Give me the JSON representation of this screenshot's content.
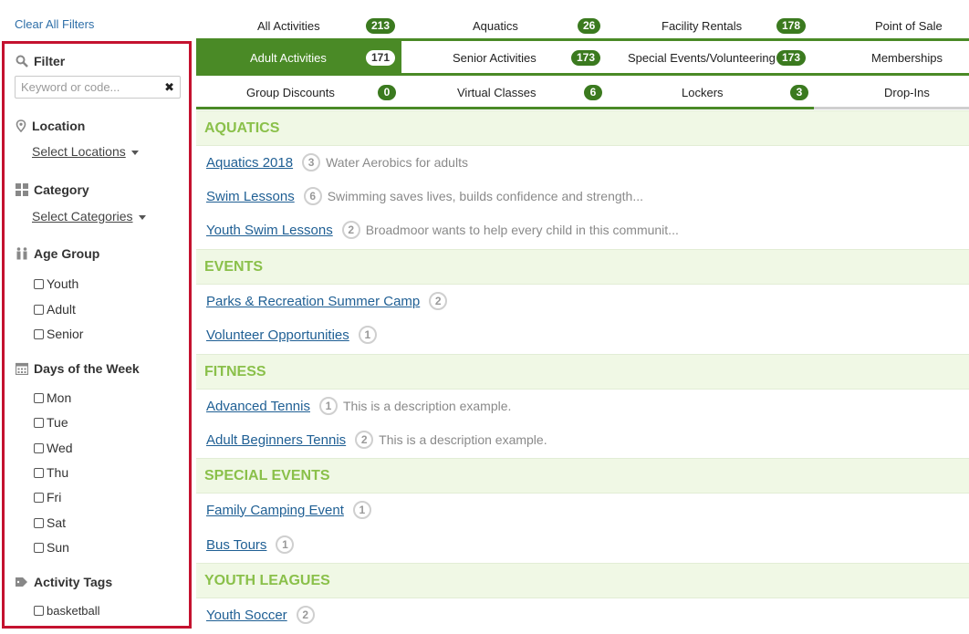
{
  "clear_filters": "Clear All Filters",
  "sidebar": {
    "filter_title": "Filter",
    "search_placeholder": "Keyword or code...",
    "clear_symbol": "✖",
    "location_title": "Location",
    "location_select": "Select Locations",
    "category_title": "Category",
    "category_select": "Select Categories",
    "age_title": "Age Group",
    "age_options": [
      "Youth",
      "Adult",
      "Senior"
    ],
    "days_title": "Days of the Week",
    "days_options": [
      "Mon",
      "Tue",
      "Wed",
      "Thu",
      "Fri",
      "Sat",
      "Sun"
    ],
    "tags_title": "Activity Tags",
    "tags_options": [
      "basketball"
    ]
  },
  "tabs": {
    "row1": [
      {
        "label": "All Activities",
        "count": "213"
      },
      {
        "label": "Aquatics",
        "count": "26"
      },
      {
        "label": "Facility Rentals",
        "count": "178"
      },
      {
        "label": "Point of Sale",
        "count": ""
      }
    ],
    "row2": [
      {
        "label": "Adult Activities",
        "count": "171"
      },
      {
        "label": "Senior Activities",
        "count": "173"
      },
      {
        "label": "Special Events/Volunteering",
        "count": "173"
      },
      {
        "label": "Memberships",
        "count": ""
      }
    ],
    "row3": [
      {
        "label": "Group Discounts",
        "count": "0"
      },
      {
        "label": "Virtual Classes",
        "count": "6"
      },
      {
        "label": "Lockers",
        "count": "3"
      },
      {
        "label": "Drop-Ins",
        "count": ""
      }
    ]
  },
  "categories": [
    {
      "name": "AQUATICS",
      "items": [
        {
          "title": "Aquatics 2018",
          "count": "3",
          "desc": "Water Aerobics for adults"
        },
        {
          "title": "Swim Lessons",
          "count": "6",
          "desc": "Swimming saves lives, builds confidence and strength..."
        },
        {
          "title": "Youth Swim Lessons",
          "count": "2",
          "desc": "Broadmoor wants to help every child in this communit..."
        }
      ]
    },
    {
      "name": "EVENTS",
      "items": [
        {
          "title": "Parks & Recreation Summer Camp",
          "count": "2",
          "desc": ""
        },
        {
          "title": "Volunteer Opportunities",
          "count": "1",
          "desc": ""
        }
      ]
    },
    {
      "name": "FITNESS",
      "items": [
        {
          "title": "Advanced Tennis",
          "count": "1",
          "desc": "This is a description example."
        },
        {
          "title": "Adult Beginners Tennis",
          "count": "2",
          "desc": "This is a description example."
        }
      ]
    },
    {
      "name": "SPECIAL EVENTS",
      "items": [
        {
          "title": "Family Camping Event",
          "count": "1",
          "desc": ""
        },
        {
          "title": "Bus Tours",
          "count": "1",
          "desc": ""
        }
      ]
    },
    {
      "name": "YOUTH LEAGUES",
      "items": [
        {
          "title": "Youth Soccer",
          "count": "2",
          "desc": ""
        }
      ]
    }
  ],
  "colors": {
    "accent_green": "#4a8a26",
    "sidebar_border": "#c4122f",
    "category_text": "#8ac04a"
  }
}
